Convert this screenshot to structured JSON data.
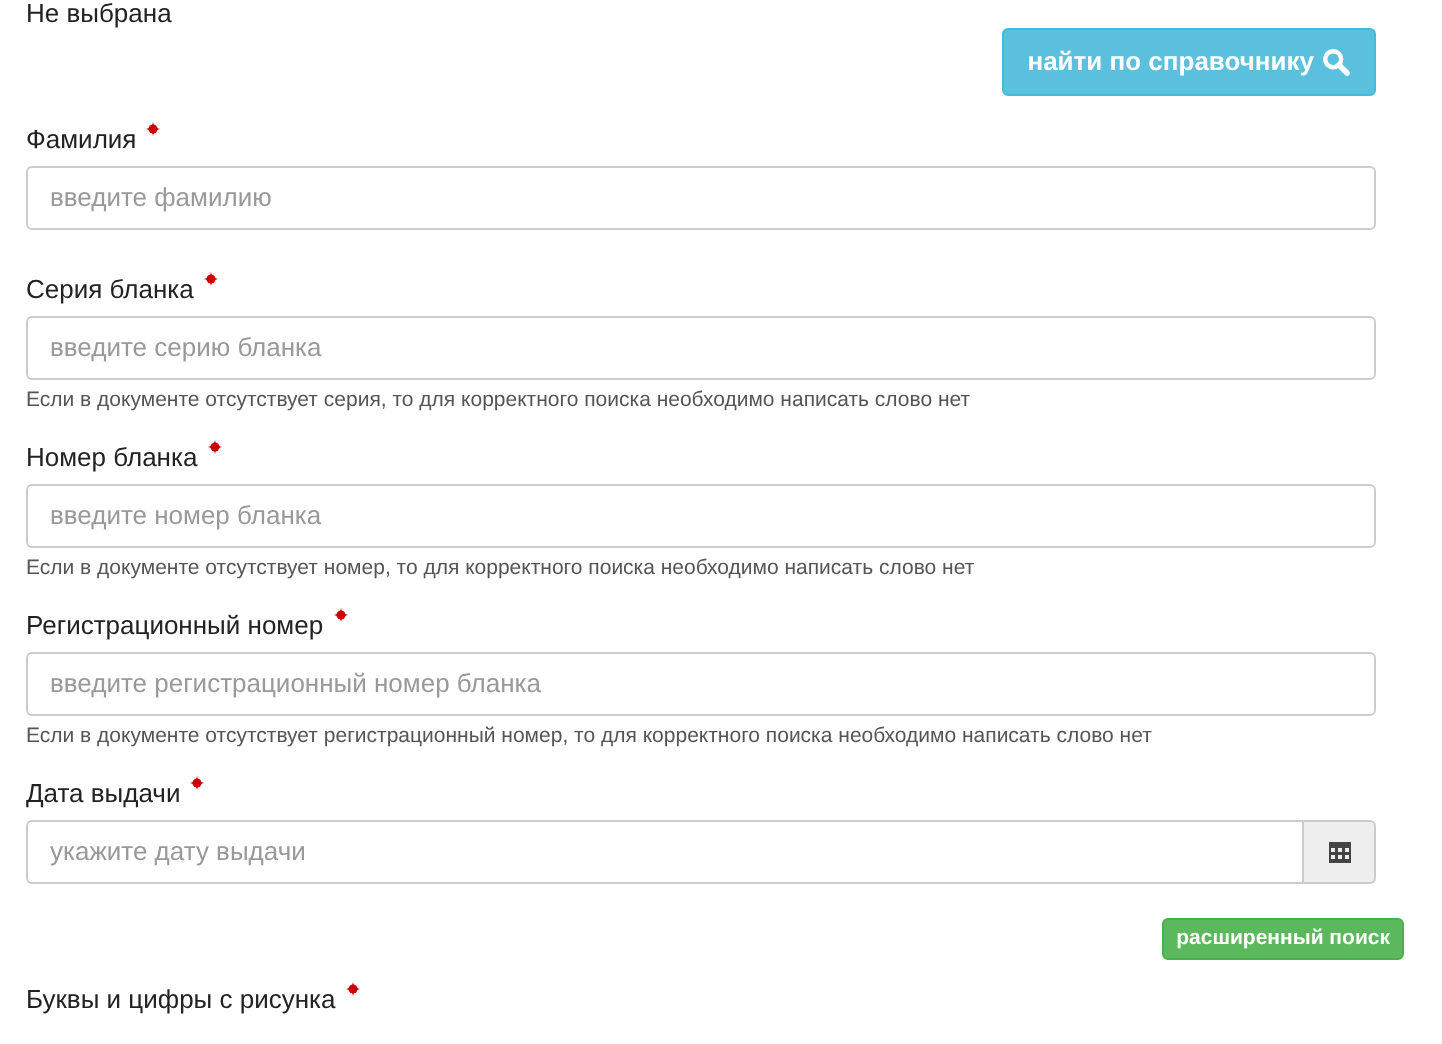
{
  "status_text": "Не выбрана",
  "directory_button": {
    "label": "найти по справочнику"
  },
  "fields": [
    {
      "kind": "text",
      "label": "Фамилия",
      "required": true,
      "placeholder": "введите фамилию"
    },
    {
      "kind": "text",
      "label": "Серия бланка",
      "required": true,
      "placeholder": "введите серию бланка",
      "help": "Если в документе отсутствует серия, то для корректного поиска необходимо написать слово нет"
    },
    {
      "kind": "text",
      "label": "Номер бланка",
      "required": true,
      "placeholder": "введите номер бланка",
      "help": "Если в документе отсутствует номер, то для корректного поиска необходимо написать слово нет"
    },
    {
      "kind": "text",
      "label": "Регистрационный номер",
      "required": true,
      "placeholder": "введите регистрационный номер бланка",
      "help": "Если в документе отсутствует регистрационный номер, то для корректного поиска необходимо написать слово нет"
    },
    {
      "kind": "date",
      "label": "Дата выдачи",
      "required": true,
      "placeholder": "укажите дату выдачи"
    }
  ],
  "advanced_button": {
    "label": "расширенный поиск"
  },
  "captcha": {
    "label": "Буквы и цифры с рисунка",
    "required": true
  }
}
